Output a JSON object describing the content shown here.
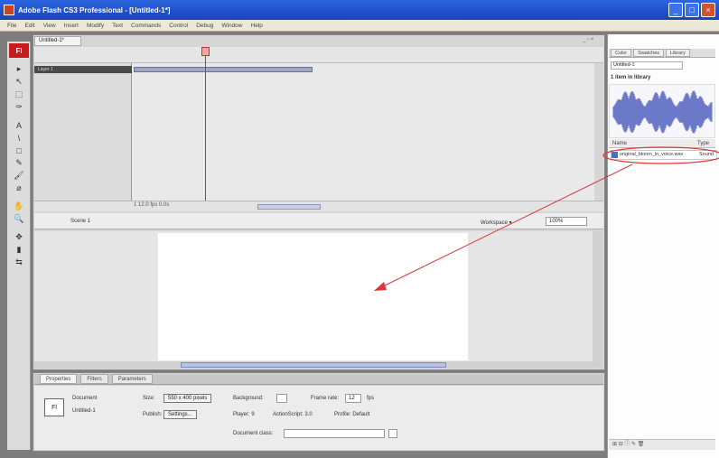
{
  "app": {
    "title": "Adobe Flash CS3 Professional - [Untitled-1*]",
    "window_buttons": [
      "_",
      "□",
      "×"
    ]
  },
  "menu": [
    "File",
    "Edit",
    "View",
    "Insert",
    "Modify",
    "Text",
    "Commands",
    "Control",
    "Debug",
    "Window",
    "Help"
  ],
  "document": {
    "tab": "Untitled-1*",
    "window_controls": "_ ▫ ×",
    "layer_name": "Layer 1",
    "timeline_status": "1   12.0 fps   0.0s",
    "scene": "Scene 1",
    "workspace_label": "Workspace ▾",
    "zoom": "100%"
  },
  "tools": [
    "▸",
    "↖",
    "⬚",
    "✑",
    "A",
    "\\",
    "□",
    "✎",
    "🖌",
    "⌀",
    "✋",
    "🔍",
    "✥",
    "▮",
    "⇆"
  ],
  "properties": {
    "tabs": [
      "Properties",
      "Filters",
      "Parameters"
    ],
    "doc_label": "Document",
    "doc_name": "Untitled-1",
    "doc_icon": "Fl",
    "size_label": "Size:",
    "size_value": "550 x 400 pixels",
    "background_label": "Background:",
    "frame_rate_label": "Frame rate:",
    "frame_rate_value": "12",
    "fps_label": "fps",
    "publish_label": "Publish:",
    "settings_button": "Settings...",
    "player_label": "Player: 9",
    "actionscript_label": "ActionScript: 3.0",
    "profile_label": "Profile: Default",
    "doc_class_label": "Document class:"
  },
  "library": {
    "tabs": [
      "Color",
      "Swatches",
      "Library"
    ],
    "doc_select": "Untitled-1",
    "item_count": "1 item in library",
    "column_name": "Name",
    "column_type": "Type",
    "item_name": "original_bloom_in_voice.wav",
    "item_type": "Sound",
    "footer": "⊞ ⊟ ⓘ ✎ 🗑"
  },
  "colors": {
    "title_blue": "#2c66e0",
    "playhead_red": "#d8262a",
    "wave_blue": "#6b79c8",
    "annotation_red": "#d83a3a"
  }
}
